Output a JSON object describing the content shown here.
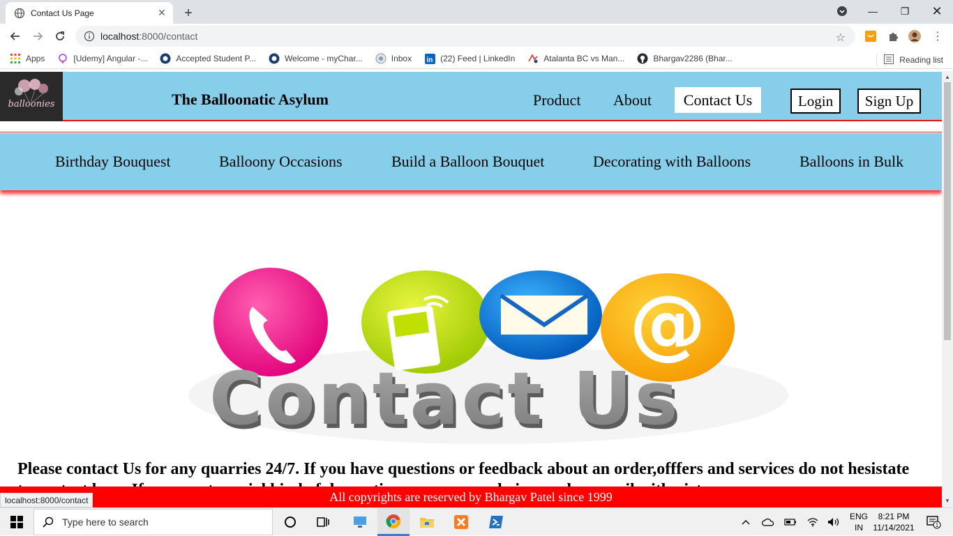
{
  "browser": {
    "tab_title": "Contact Us Page",
    "url_host": "localhost",
    "url_path": ":8000/contact",
    "status_url": "localhost:8000/contact"
  },
  "bookmarks": [
    {
      "label": "Apps",
      "icon": "apps-grid-icon"
    },
    {
      "label": "[Udemy] Angular -...",
      "icon": "udemy-icon"
    },
    {
      "label": "Accepted Student P...",
      "icon": "university-icon"
    },
    {
      "label": "Welcome - myChar...",
      "icon": "university-icon"
    },
    {
      "label": "Inbox",
      "icon": "mail-icon"
    },
    {
      "label": "(22) Feed | LinkedIn",
      "icon": "linkedin-icon"
    },
    {
      "label": "Atalanta BC vs Man...",
      "icon": "sports-icon"
    },
    {
      "label": "Bhargav2286 (Bhar...",
      "icon": "github-icon"
    }
  ],
  "reading_list": "Reading list",
  "site": {
    "brand": "The Balloonatic Asylum",
    "logo_text": "balloonies",
    "nav": {
      "product": "Product",
      "about": "About",
      "contact": "Contact Us"
    },
    "auth": {
      "login": "Login",
      "signup": "Sign Up"
    },
    "categories": [
      "Birthday Bouquest",
      "Balloony Occasions",
      "Build a Balloon Bouquet",
      "Decorating with Balloons",
      "Balloons in Bulk"
    ],
    "hero_text": "Contact Us",
    "paragraph": "Please contact Us for any quarries 24/7. If you have questions or feedback about an order,offfers and services do not hesistate to contact here. If you want special kind of decoration as per your choice send us email with picture.",
    "footer": "All copyrights are reserved by Bhargav Patel since 1999"
  },
  "colors": {
    "header_bg": "#87ceeb",
    "accent": "#ff0000",
    "footer_bg": "#ff0000"
  },
  "taskbar": {
    "search_placeholder": "Type here to search",
    "lang_top": "ENG",
    "lang_bottom": "IN",
    "time": "8:21 PM",
    "date": "11/14/2021",
    "notif_count": "1"
  }
}
